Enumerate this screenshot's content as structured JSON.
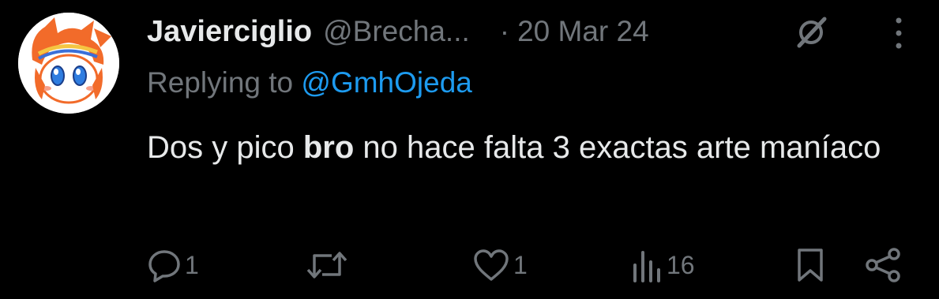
{
  "tweet": {
    "display_name": "Javierciglio",
    "handle": "@Brecha...",
    "separator": "·",
    "date": "20 Mar 24",
    "replying_prefix": "Replying to ",
    "replying_to": "@GmhOjeda",
    "body_before": "Dos y pico ",
    "body_bold": "bro",
    "body_after": " no hace falta 3 exactas arte maníaco"
  },
  "actions": {
    "replies": "1",
    "retweets": "",
    "likes": "1",
    "views": "16"
  },
  "icons": {
    "reply": "reply-icon",
    "retweet": "retweet-icon",
    "like": "heart-icon",
    "views": "views-icon",
    "bookmark": "bookmark-icon",
    "share": "share-icon",
    "grok": "grok-icon",
    "more": "more-icon"
  },
  "colors": {
    "background": "#000000",
    "text": "#e7e9ea",
    "muted": "#71767b",
    "link": "#1d9bf0",
    "avatar_orange": "#f26b2a"
  }
}
